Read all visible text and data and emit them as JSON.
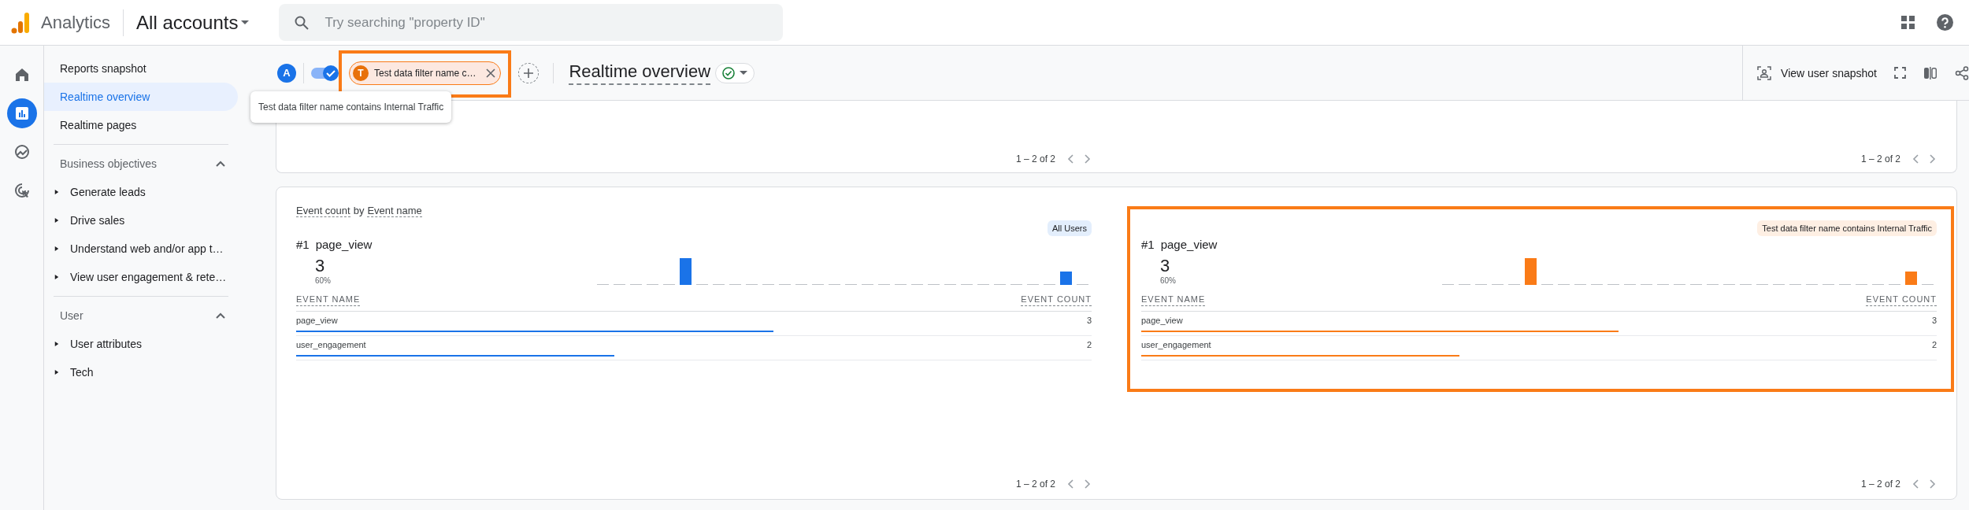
{
  "app": {
    "name": "Analytics",
    "account": "All accounts"
  },
  "search": {
    "placeholder": "Try searching \"property ID\""
  },
  "rail": [
    {
      "kind": "home",
      "selected": false
    },
    {
      "kind": "reports",
      "selected": true
    },
    {
      "kind": "explore",
      "selected": false
    },
    {
      "kind": "advertising",
      "selected": false
    }
  ],
  "sidebar": {
    "items": [
      {
        "label": "Reports snapshot",
        "selected": false
      },
      {
        "label": "Realtime overview",
        "selected": true
      },
      {
        "label": "Realtime pages",
        "selected": false
      }
    ],
    "sections": [
      {
        "title": "Business objectives",
        "expanded": true,
        "children": [
          {
            "label": "Generate leads",
            "expanded": false
          },
          {
            "label": "Drive sales",
            "expanded": false
          },
          {
            "label": "Understand web and/or app t…",
            "expanded": false
          },
          {
            "label": "View user engagement & rete…",
            "expanded": false
          }
        ]
      },
      {
        "title": "User",
        "expanded": true,
        "children": [
          {
            "label": "User attributes",
            "expanded": false
          },
          {
            "label": "Tech",
            "expanded": false
          }
        ]
      }
    ]
  },
  "toolbar": {
    "avatar": "A",
    "comparison_on": true,
    "chip": {
      "initial": "T",
      "label": "Test data filter name c…",
      "highlighted": true
    },
    "title": "Realtime overview",
    "status_ok": true,
    "snapshot_button": "View user snapshot"
  },
  "tooltip": "Test data filter name contains Internal Traffic",
  "top_card": {
    "paginations": [
      "1 – 2 of 2",
      "1 – 2 of 2"
    ]
  },
  "event_card": {
    "title_parts": [
      {
        "text": "Event count",
        "dashed": true
      },
      {
        "text": "by",
        "dashed": false
      },
      {
        "text": "Event name",
        "dashed": true
      }
    ],
    "panels": [
      {
        "badge": "All Users",
        "color": "#1a73e8",
        "highlighted": false,
        "rank": "#1",
        "top_event": "page_view",
        "top_value": "3",
        "top_share": "60%",
        "columns": [
          "EVENT NAME",
          "EVENT COUNT"
        ],
        "rows": [
          {
            "name": "page_view",
            "count": "3",
            "level": 0.6
          },
          {
            "name": "user_engagement",
            "count": "2",
            "level": 0.4
          }
        ],
        "pagination": "1 – 2 of 2"
      },
      {
        "badge": "Test data filter name contains Internal Traffic",
        "color": "#fa7b17",
        "highlighted": true,
        "rank": "#1",
        "top_event": "page_view",
        "top_value": "3",
        "top_share": "60%",
        "columns": [
          "EVENT NAME",
          "EVENT COUNT"
        ],
        "rows": [
          {
            "name": "page_view",
            "count": "3",
            "level": 0.6
          },
          {
            "name": "user_engagement",
            "count": "2",
            "level": 0.4
          }
        ],
        "pagination": "1 – 2 of 2"
      }
    ]
  }
}
